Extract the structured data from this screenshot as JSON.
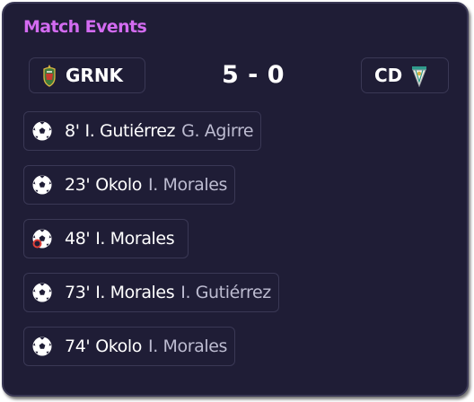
{
  "header": {
    "title": "Match Events"
  },
  "match": {
    "home_team": "GRNK",
    "away_team": "CD",
    "score": "5 - 0"
  },
  "events": [
    {
      "type": "goal",
      "icon": "soccer-ball-icon",
      "minute": "8'",
      "scorer": "I. Gutiérrez",
      "assist": "G. Agirre"
    },
    {
      "type": "goal",
      "icon": "soccer-ball-icon",
      "minute": "23'",
      "scorer": "Okolo",
      "assist": "I. Morales"
    },
    {
      "type": "penalty-goal",
      "icon": "penalty-goal-icon",
      "minute": "48'",
      "scorer": "I. Morales",
      "assist": ""
    },
    {
      "type": "goal",
      "icon": "soccer-ball-icon",
      "minute": "73'",
      "scorer": "I. Morales",
      "assist": "I. Gutiérrez"
    },
    {
      "type": "goal",
      "icon": "soccer-ball-icon",
      "minute": "74'",
      "scorer": "Okolo",
      "assist": "I. Morales"
    }
  ],
  "colors": {
    "card_background": "#1f1d36",
    "title_accent": "#d36bf1",
    "border": "#3a3855",
    "assist_text": "#bdbcd1",
    "penalty_marker": "#e0413a"
  }
}
